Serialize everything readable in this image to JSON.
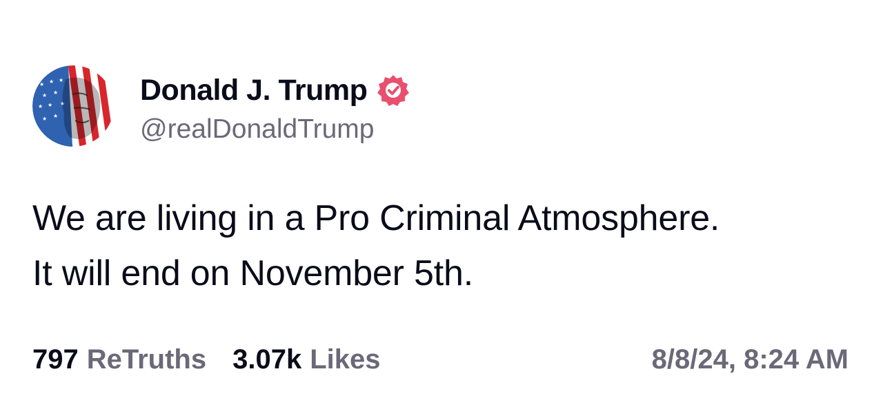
{
  "author": {
    "display_name": "Donald J. Trump",
    "handle": "@realDonaldTrump",
    "verified": true,
    "verified_badge_color": "#e8506e",
    "avatar_icon": "flag-portrait-avatar"
  },
  "post": {
    "lines": [
      "We are living in a Pro Criminal Atmosphere.",
      "It will end on November 5th."
    ]
  },
  "stats": {
    "retruths_count": "797",
    "retruths_label": "ReTruths",
    "likes_count": "3.07k",
    "likes_label": "Likes"
  },
  "timestamp": "8/8/24, 8:24 AM",
  "colors": {
    "text_primary": "#0b0b1a",
    "text_secondary": "#6b6878",
    "background": "#ffffff"
  }
}
